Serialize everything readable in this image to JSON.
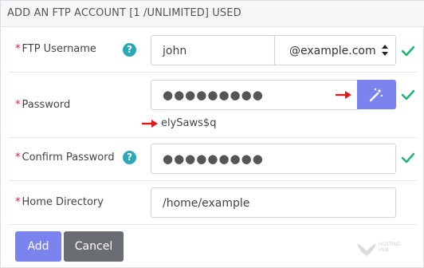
{
  "header": {
    "title": "ADD AN FTP ACCOUNT [1 /UNLIMITED] USED"
  },
  "form": {
    "username": {
      "label": "FTP Username",
      "required_mark": "*",
      "value": "john",
      "domain": "@example.com",
      "help": "?"
    },
    "password": {
      "label": "Password",
      "required_mark": "*",
      "value_masked": "●●●●●●●●●",
      "generated": "elySaws$q"
    },
    "confirm": {
      "label": "Confirm Password",
      "required_mark": "*",
      "value_masked": "●●●●●●●●●",
      "help": "?"
    },
    "home": {
      "label": "Home Directory",
      "required_mark": "*",
      "value": "/home/example"
    }
  },
  "actions": {
    "add_label": "Add",
    "cancel_label": "Cancel"
  },
  "watermark": {
    "text_line1": "HOSTING",
    "text_line2": "HUB"
  },
  "icons": {
    "help": "question-circle-icon",
    "generator": "magic-wand-icon",
    "valid": "check-icon",
    "annotation": "red-arrow-icon",
    "select": "select-caret-icon"
  },
  "colors": {
    "accent": "#7b83ee",
    "cancel": "#6a6d72",
    "help": "#2aa8b8",
    "check": "#22b573",
    "required": "#e0213f",
    "annotation": "#e01a1a"
  }
}
